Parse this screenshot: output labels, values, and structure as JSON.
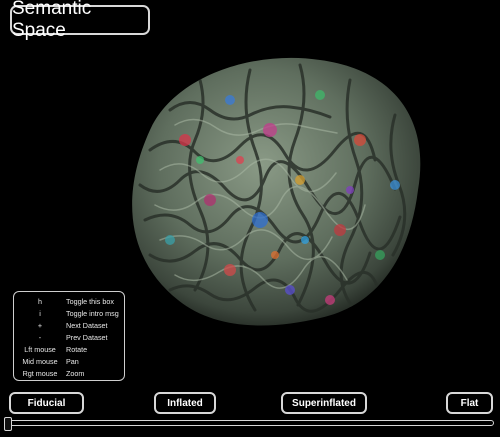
{
  "title": "Semantic Space",
  "help": {
    "rows": [
      {
        "key": "h",
        "action": "Toggle this box"
      },
      {
        "key": "i",
        "action": "Toggle intro msg"
      },
      {
        "key": "+",
        "action": "Next Dataset"
      },
      {
        "key": "-",
        "action": "Prev Dataset"
      },
      {
        "key": "Lft mouse",
        "action": "Rotate"
      },
      {
        "key": "Mid mouse",
        "action": "Pan"
      },
      {
        "key": "Rgt mouse",
        "action": "Zoom"
      }
    ]
  },
  "buttons": {
    "fiducial": "Fiducial",
    "inflated": "Inflated",
    "superinflated": "Superinflated",
    "flat": "Flat"
  },
  "slider": {
    "value": 0
  },
  "colors": {
    "background": "#000000",
    "border": "#d8d8d8",
    "brain_base": "#6b7a6a"
  }
}
